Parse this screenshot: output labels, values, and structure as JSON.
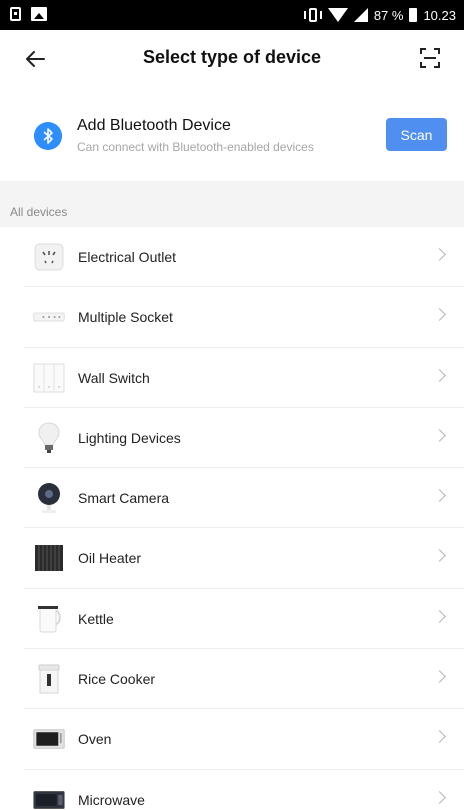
{
  "status_bar": {
    "battery": "87 %",
    "time": "10.23"
  },
  "header": {
    "title": "Select type of device"
  },
  "bluetooth": {
    "title": "Add Bluetooth Device",
    "subtitle": "Can connect with Bluetooth-enabled devices",
    "scan_label": "Scan"
  },
  "section": {
    "label": "All devices"
  },
  "devices": [
    {
      "label": "Electrical Outlet",
      "icon": "outlet-icon"
    },
    {
      "label": "Multiple Socket",
      "icon": "power-strip-icon"
    },
    {
      "label": "Wall Switch",
      "icon": "wall-switch-icon"
    },
    {
      "label": "Lighting Devices",
      "icon": "light-bulb-icon"
    },
    {
      "label": "Smart Camera",
      "icon": "camera-icon"
    },
    {
      "label": "Oil Heater",
      "icon": "heater-icon"
    },
    {
      "label": "Kettle",
      "icon": "kettle-icon"
    },
    {
      "label": "Rice Cooker",
      "icon": "rice-cooker-icon"
    },
    {
      "label": "Oven",
      "icon": "oven-icon"
    },
    {
      "label": "Microwave",
      "icon": "microwave-icon"
    }
  ],
  "colors": {
    "accent": "#4f8ff0",
    "bluetooth": "#2f8eff"
  }
}
